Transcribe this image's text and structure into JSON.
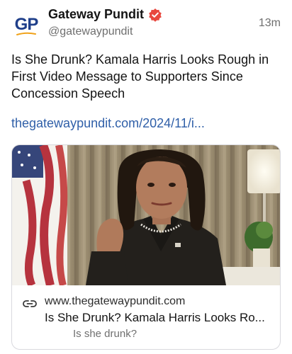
{
  "account": {
    "avatar_text": "GP",
    "name": "Gateway Pundit",
    "handle": "@gatewaypundit",
    "verified": true,
    "time": "13m"
  },
  "post": {
    "text": "Is She Drunk? Kamala Harris Looks Rough in First Video Message to Supporters Since Concession Speech",
    "link_text": "thegatewaypundit.com/2024/11/i..."
  },
  "link_card": {
    "icon": "link-icon",
    "domain": "www.thegatewaypundit.com",
    "title": "Is She Drunk? Kamala Harris Looks Ro...",
    "description": "Is she drunk?"
  },
  "colors": {
    "link": "#2f5fa8",
    "verified": "#e8483f",
    "avatar_brand": "#1f3f8a",
    "secondary_text": "#6f6f6f"
  }
}
